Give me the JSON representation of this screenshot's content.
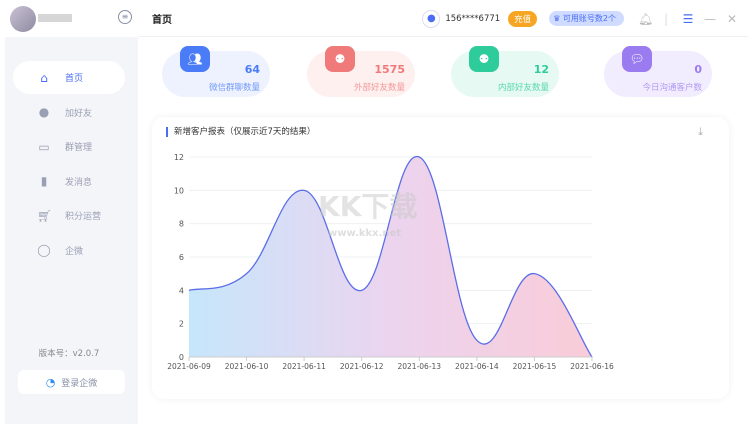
{
  "header": {
    "title": "首页",
    "phone": "156****6771",
    "charge": "充值",
    "accounts": "可用账号数2个"
  },
  "sidebar": {
    "items": [
      {
        "label": "首页",
        "icon": "home-icon"
      },
      {
        "label": "加好友",
        "icon": "user-icon"
      },
      {
        "label": "群管理",
        "icon": "group-icon"
      },
      {
        "label": "发消息",
        "icon": "bar-icon"
      },
      {
        "label": "积分运营",
        "icon": "cart-icon"
      },
      {
        "label": "企微",
        "icon": "chat-icon"
      }
    ],
    "version": "版本号：v2.0.7",
    "login": "登录企微"
  },
  "stats": [
    {
      "value": "64",
      "label": "微信群聊数量",
      "color": "#4a7cf7",
      "bg": "#eef2ff"
    },
    {
      "value": "1575",
      "label": "外部好友数量",
      "color": "#f07a7a",
      "bg": "#fff0f0"
    },
    {
      "value": "12",
      "label": "内部好友数量",
      "color": "#2ecc9a",
      "bg": "#e6faf3"
    },
    {
      "value": "0",
      "label": "今日沟通客户数",
      "color": "#9a7cf0",
      "bg": "#f1edff"
    }
  ],
  "chart": {
    "title": "新增客户报表（仅展示近7天的结果）"
  },
  "watermark": {
    "text": "KK下载",
    "url": "www.kkx.net"
  },
  "chart_data": {
    "type": "area",
    "title": "新增客户报表（仅展示近7天的结果）",
    "categories": [
      "2021-06-09",
      "2021-06-10",
      "2021-06-11",
      "2021-06-12",
      "2021-06-13",
      "2021-06-14",
      "2021-06-15",
      "2021-06-16"
    ],
    "values": [
      4,
      5,
      10,
      4,
      12,
      1,
      5,
      0
    ],
    "ylim": [
      0,
      12
    ],
    "yticks": [
      0,
      2,
      4,
      6,
      8,
      10,
      12
    ],
    "grid": true
  }
}
